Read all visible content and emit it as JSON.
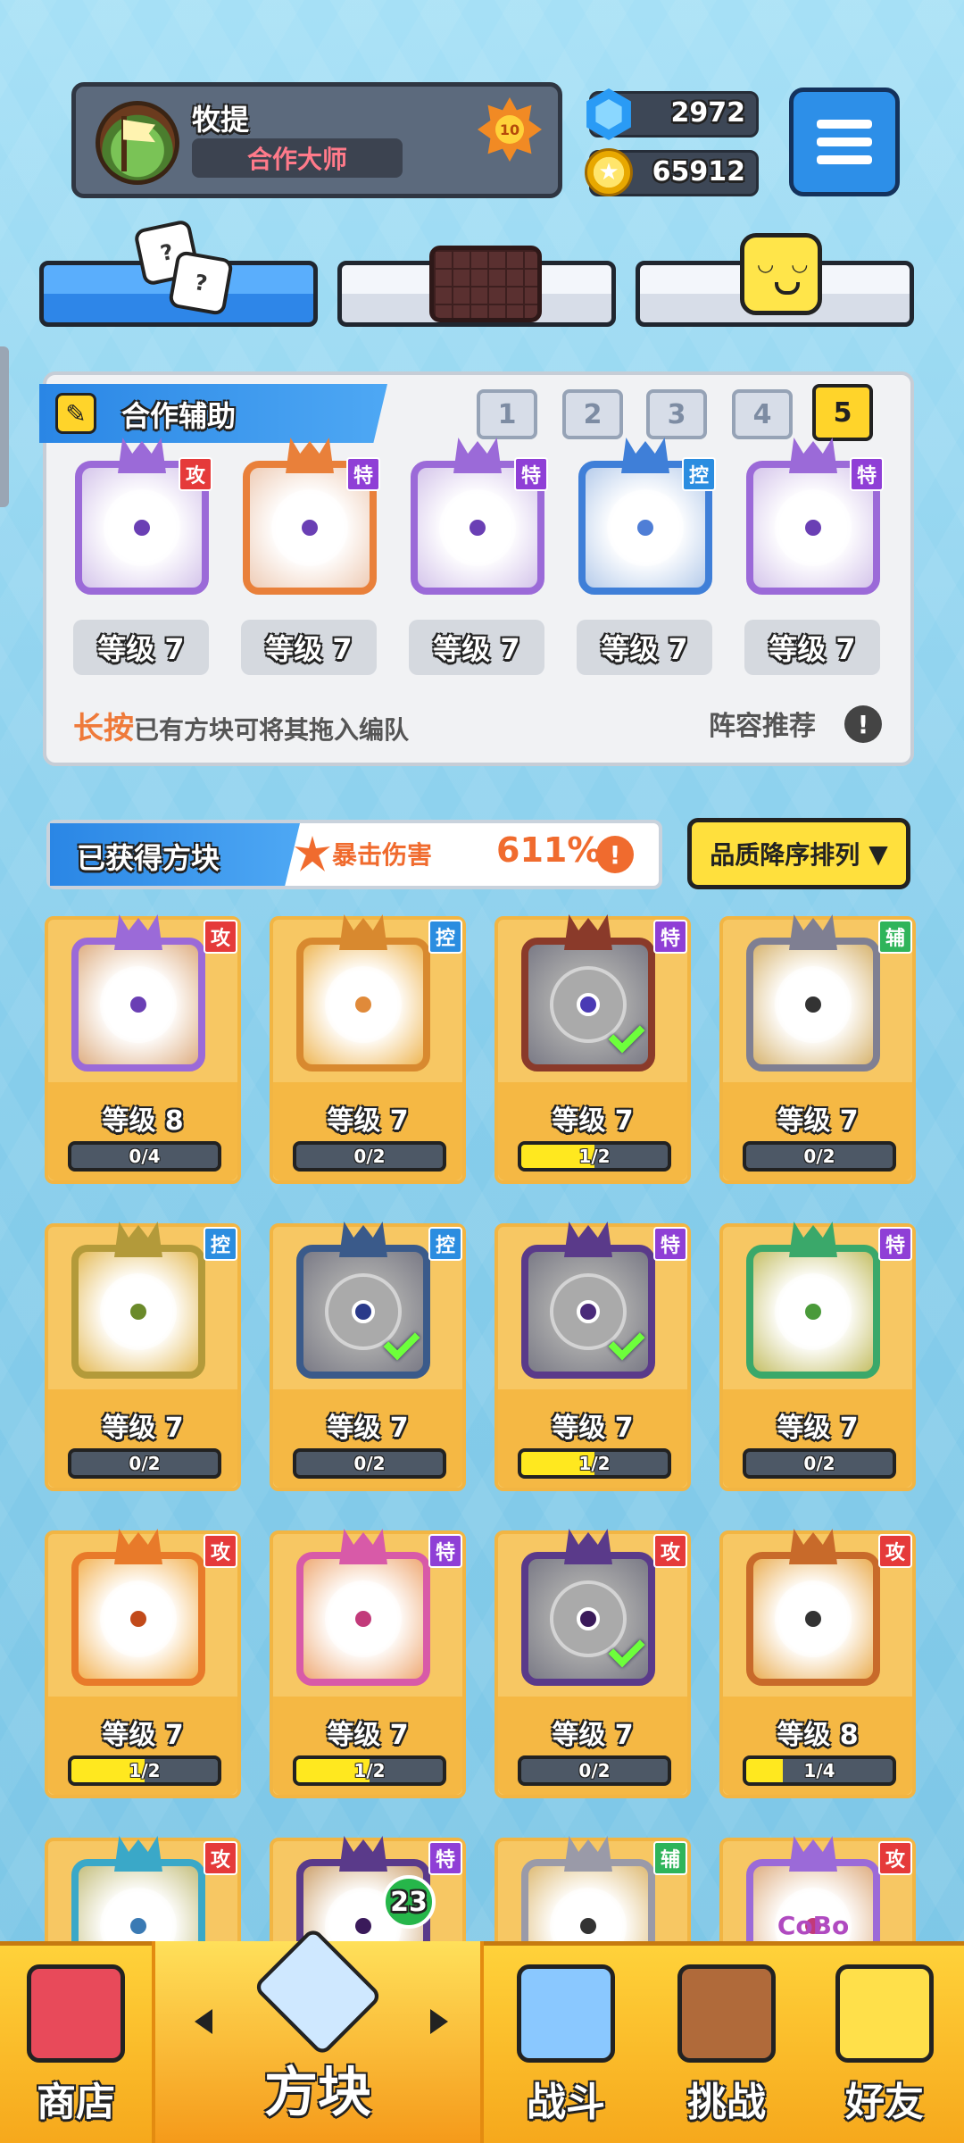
{
  "header": {
    "player_name": "牧提",
    "player_title": "合作大师",
    "level_badge": "10",
    "gems": "2972",
    "coins": "65912",
    "menu_icon": "hamburger-menu-icon"
  },
  "top_tabs": [
    {
      "name": "dice-tab",
      "icon": "dice-icon",
      "active": true
    },
    {
      "name": "board-tab",
      "icon": "chocolate-board-icon",
      "active": false
    },
    {
      "name": "emote-tab",
      "icon": "smiley-cube-icon",
      "active": false
    }
  ],
  "team": {
    "title": "合作辅助",
    "deck_numbers": [
      "1",
      "2",
      "3",
      "4",
      "5"
    ],
    "active_deck": "5",
    "slots": [
      {
        "type_tag": "攻",
        "level": "等级 7",
        "color": "#9b6ad8",
        "core": "#6a3fb4",
        "tag_color": "#e53a3a"
      },
      {
        "type_tag": "特",
        "level": "等级 7",
        "color": "#e9803a",
        "core": "#6a3fb4",
        "tag_color": "#8f3fd6"
      },
      {
        "type_tag": "特",
        "level": "等级 7",
        "color": "#9b6ad8",
        "core": "#6a3fb4",
        "tag_color": "#8f3fd6"
      },
      {
        "type_tag": "控",
        "level": "等级 7",
        "color": "#3f7fd8",
        "core": "#4f7ed6",
        "tag_color": "#2b8de0"
      },
      {
        "type_tag": "特",
        "level": "等级 7",
        "color": "#9b6ad8",
        "core": "#6a3fb4",
        "tag_color": "#8f3fd6"
      }
    ],
    "hint_strong": "长按",
    "hint_rest": "已有方块可将其拖入编队",
    "recommend_label": "阵容推荐",
    "recommend_icon": "!"
  },
  "owned": {
    "title": "已获得方块",
    "crit_label": "暴击伤害",
    "crit_value": "611%",
    "crit_info": "!",
    "sort_label": "品质降序排列",
    "sort_arrow": "▼",
    "cards": [
      {
        "tag": "攻",
        "tag_color": "#e53a3a",
        "level": "等级 8",
        "progress_text": "0/4",
        "progress": 0,
        "color": "#9b6ad8",
        "core": "#6a3fb4",
        "check": false
      },
      {
        "tag": "控",
        "tag_color": "#2b8de0",
        "level": "等级 7",
        "progress_text": "0/2",
        "progress": 0,
        "color": "#d8892f",
        "core": "#e08a3a",
        "check": false
      },
      {
        "tag": "特",
        "tag_color": "#8f3fd6",
        "level": "等级 7",
        "progress_text": "1/2",
        "progress": 0.5,
        "color": "#8a3a2a",
        "core": "#4a3ab4",
        "check": true
      },
      {
        "tag": "辅",
        "tag_color": "#2fb45a",
        "level": "等级 7",
        "progress_text": "0/2",
        "progress": 0,
        "color": "#7f7f92",
        "core": "#333333",
        "check": false
      },
      {
        "tag": "控",
        "tag_color": "#2b8de0",
        "level": "等级 7",
        "progress_text": "0/2",
        "progress": 0,
        "color": "#b39a3a",
        "core": "#6b8a2a",
        "check": false
      },
      {
        "tag": "控",
        "tag_color": "#2b8de0",
        "level": "等级 7",
        "progress_text": "0/2",
        "progress": 0,
        "color": "#3a5a8a",
        "core": "#2a3a8a",
        "check": true
      },
      {
        "tag": "特",
        "tag_color": "#8f3fd6",
        "level": "等级 7",
        "progress_text": "1/2",
        "progress": 0.5,
        "color": "#5a3a8a",
        "core": "#4a2a7a",
        "check": true
      },
      {
        "tag": "特",
        "tag_color": "#8f3fd6",
        "level": "等级 7",
        "progress_text": "0/2",
        "progress": 0,
        "color": "#3aa86a",
        "core": "#4a9a3a",
        "check": false
      },
      {
        "tag": "攻",
        "tag_color": "#e53a3a",
        "level": "等级 7",
        "progress_text": "1/2",
        "progress": 0.5,
        "color": "#e87a2a",
        "core": "#c24a1a",
        "check": false
      },
      {
        "tag": "特",
        "tag_color": "#8f3fd6",
        "level": "等级 7",
        "progress_text": "1/2",
        "progress": 0.5,
        "color": "#d85aa8",
        "core": "#c23a7a",
        "check": false
      },
      {
        "tag": "攻",
        "tag_color": "#e53a3a",
        "level": "等级 7",
        "progress_text": "0/2",
        "progress": 0,
        "color": "#5a3a8a",
        "core": "#3a1a5a",
        "check": true
      },
      {
        "tag": "攻",
        "tag_color": "#e53a3a",
        "level": "等级 8",
        "progress_text": "1/4",
        "progress": 0.25,
        "color": "#c86a2a",
        "core": "#333333",
        "check": false
      },
      {
        "tag": "攻",
        "tag_color": "#e53a3a",
        "level": "",
        "progress_text": "",
        "progress": 0,
        "color": "#3aa8c8",
        "core": "#3a7ab4",
        "check": false
      },
      {
        "tag": "特",
        "tag_color": "#8f3fd6",
        "level": "",
        "progress_text": "",
        "progress": 0,
        "color": "#5a3a8a",
        "core": "#3a1a5a",
        "check": false
      },
      {
        "tag": "辅",
        "tag_color": "#2fb45a",
        "level": "",
        "progress_text": "",
        "progress": 0,
        "color": "#9a9aa8",
        "core": "#333333",
        "check": false
      },
      {
        "tag": "攻",
        "tag_color": "#e53a3a",
        "level": "",
        "progress_text": "",
        "progress": 0,
        "color": "#9b6ad8",
        "core": "#c23a7a",
        "check": false,
        "overlay_text": "CoBo"
      }
    ]
  },
  "nav": {
    "items": [
      {
        "label": "商店",
        "icon": "shop-icon"
      },
      {
        "label": "方块",
        "icon": "mystery-cube-icon",
        "badge": "23",
        "active": true
      },
      {
        "label": "战斗",
        "icon": "battle-icon"
      },
      {
        "label": "挑战",
        "icon": "challenge-icon"
      },
      {
        "label": "好友",
        "icon": "friends-icon"
      }
    ]
  }
}
